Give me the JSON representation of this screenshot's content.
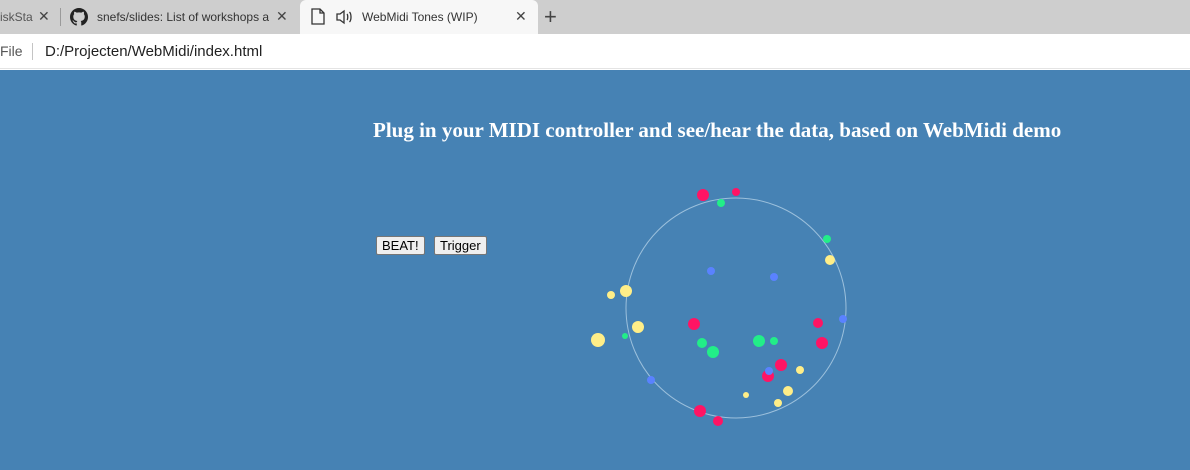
{
  "tabs": [
    {
      "label": "iskSta",
      "active": false
    },
    {
      "label": "snefs/slides: List of workshops ar",
      "active": false
    },
    {
      "label": "WebMidi Tones (WIP)",
      "active": true
    }
  ],
  "address": {
    "scheme_label": "File",
    "url": "D:/Projecten/WebMidi/index.html"
  },
  "page": {
    "heading": "Plug in your MIDI controller and see/hear the data, based on WebMidi demo",
    "beat_button": "BEAT!",
    "trigger_button": "Trigger"
  },
  "colors": {
    "background": "#4682b4",
    "dot_red": "#ff1464",
    "dot_yellow": "#ffee88",
    "dot_green": "#22ee88",
    "dot_blue": "#5a82ff",
    "ring": "#9cc0dc"
  }
}
